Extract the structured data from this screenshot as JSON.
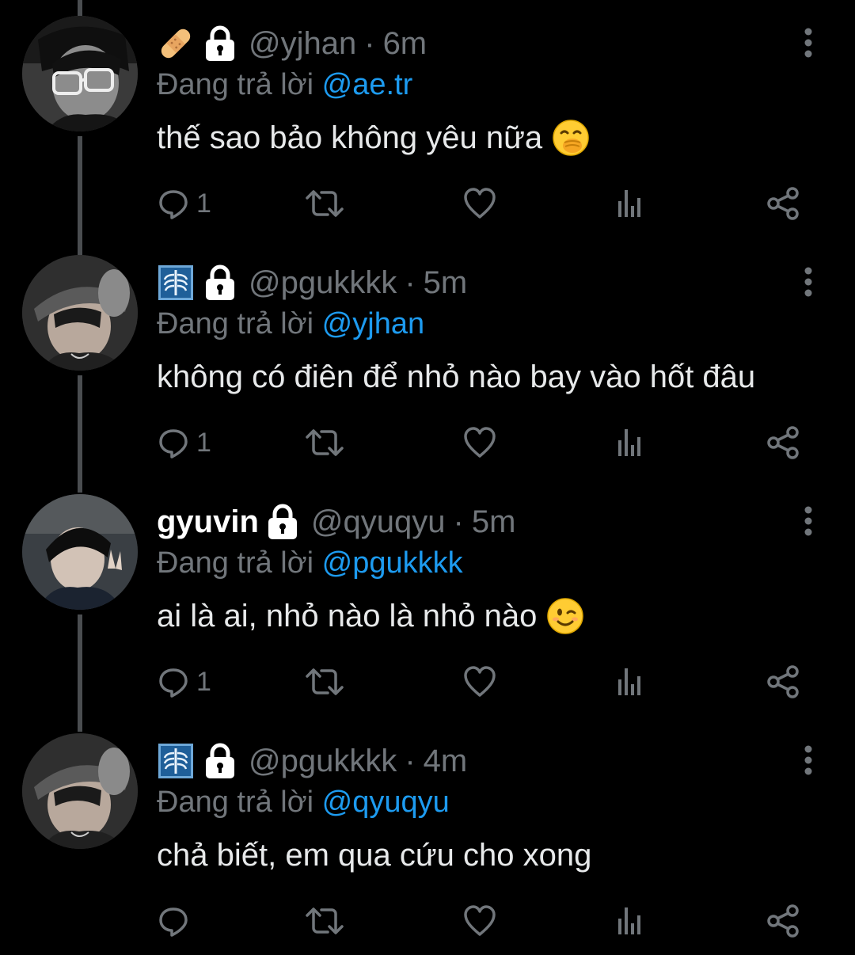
{
  "tweets": [
    {
      "display_name": "",
      "badge_icon": "bandage-emoji",
      "lock_icon": "lock-emoji",
      "handle": "@yjhan",
      "time": "6m",
      "reply_prefix": "Đang trả lời",
      "reply_to": "@ae.tr",
      "text": "thế sao bảo không yêu nữa",
      "text_emoji": "face-with-hand-over-mouth-emoji",
      "reply_count": "1"
    },
    {
      "display_name": "",
      "badge_icon": "xray-emoji",
      "lock_icon": "lock-emoji",
      "handle": "@pgukkkk",
      "time": "5m",
      "reply_prefix": "Đang trả lời",
      "reply_to": "@yjhan",
      "text": "không có điên để nhỏ nào bay vào hốt đâu",
      "text_emoji": "",
      "reply_count": "1"
    },
    {
      "display_name": "gyuvin",
      "badge_icon": "",
      "lock_icon": "lock-emoji",
      "handle": "@qyuqyu",
      "time": "5m",
      "reply_prefix": "Đang trả lời",
      "reply_to": "@pgukkkk",
      "text": "ai là ai, nhỏ nào là nhỏ nào",
      "text_emoji": "winking-face-emoji",
      "reply_count": "1"
    },
    {
      "display_name": "",
      "badge_icon": "xray-emoji",
      "lock_icon": "lock-emoji",
      "handle": "@pgukkkk",
      "time": "4m",
      "reply_prefix": "Đang trả lời",
      "reply_to": "@qyuqyu",
      "text": "chả biết, em qua cứu cho xong",
      "text_emoji": "",
      "reply_count": ""
    }
  ],
  "separator": "·",
  "colors": {
    "background": "#000000",
    "text": "#e7e9ea",
    "muted": "#71767b",
    "mention": "#1d9bf0",
    "thread_line": "#4a4d50"
  }
}
